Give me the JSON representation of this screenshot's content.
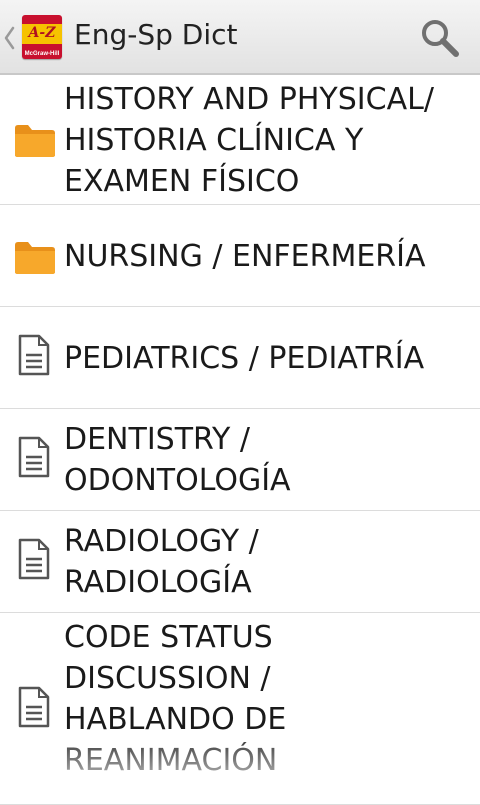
{
  "header": {
    "title": "Eng-Sp Dict",
    "app_icon_text": "A-Z",
    "app_icon_brand": "McGraw-Hill",
    "back_icon": "chevron-left-icon",
    "search_icon": "search-icon"
  },
  "list": {
    "items": [
      {
        "type": "folder",
        "icon": "folder-icon",
        "lines": [
          "HISTORY AND PHYSICAL/",
          "HISTORIA CLÍNICA Y",
          "EXAMEN FÍSICO"
        ]
      },
      {
        "type": "folder",
        "icon": "folder-icon",
        "lines": [
          "NURSING / ENFERMERÍA"
        ]
      },
      {
        "type": "document",
        "icon": "document-icon",
        "lines": [
          "PEDIATRICS / PEDIATRÍA"
        ]
      },
      {
        "type": "document",
        "icon": "document-icon",
        "lines": [
          "DENTISTRY /",
          "ODONTOLOGÍA"
        ]
      },
      {
        "type": "document",
        "icon": "document-icon",
        "lines": [
          "RADIOLOGY /",
          "RADIOLOGÍA"
        ]
      },
      {
        "type": "document",
        "icon": "document-icon",
        "lines": [
          "CODE STATUS",
          "DISCUSSION /",
          "HABLANDO DE",
          "REANIMACIÓN"
        ]
      }
    ]
  },
  "colors": {
    "folder": "#f7a82b",
    "folder_dark": "#e8901a",
    "text": "#1a1a1a",
    "divider": "#dcdcdc",
    "action_bar": "#ececec"
  }
}
